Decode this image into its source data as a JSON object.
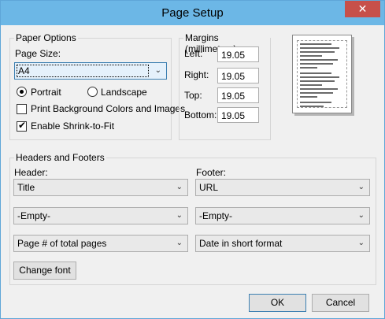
{
  "window": {
    "title": "Page Setup",
    "close_symbol": "✕"
  },
  "paper_options": {
    "group_label": "Paper Options",
    "page_size_label": "Page Size:",
    "page_size_value": "A4",
    "portrait_label": "Portrait",
    "landscape_label": "Landscape",
    "orientation_selected": "Portrait",
    "print_background_label": "Print Background Colors and Images",
    "print_background_checked": false,
    "shrink_to_fit_label": "Enable Shrink-to-Fit",
    "shrink_to_fit_checked": true
  },
  "margins": {
    "group_label": "Margins (millimeters)",
    "left_label": "Left:",
    "left_value": "19.05",
    "right_label": "Right:",
    "right_value": "19.05",
    "top_label": "Top:",
    "top_value": "19.05",
    "bottom_label": "Bottom:",
    "bottom_value": "19.05"
  },
  "headers_footers": {
    "group_label": "Headers and Footers",
    "header_label": "Header:",
    "footer_label": "Footer:",
    "header_1": "Title",
    "header_2": "-Empty-",
    "header_3": "Page # of total pages",
    "footer_1": "URL",
    "footer_2": "-Empty-",
    "footer_3": "Date in short format",
    "change_font_label": "Change font"
  },
  "buttons": {
    "ok_label": "OK",
    "cancel_label": "Cancel"
  },
  "icons": {
    "chevron": "chevron-down-icon",
    "check": "✔"
  },
  "colors": {
    "titlebar": "#6cb7e6",
    "close": "#c7504a"
  }
}
